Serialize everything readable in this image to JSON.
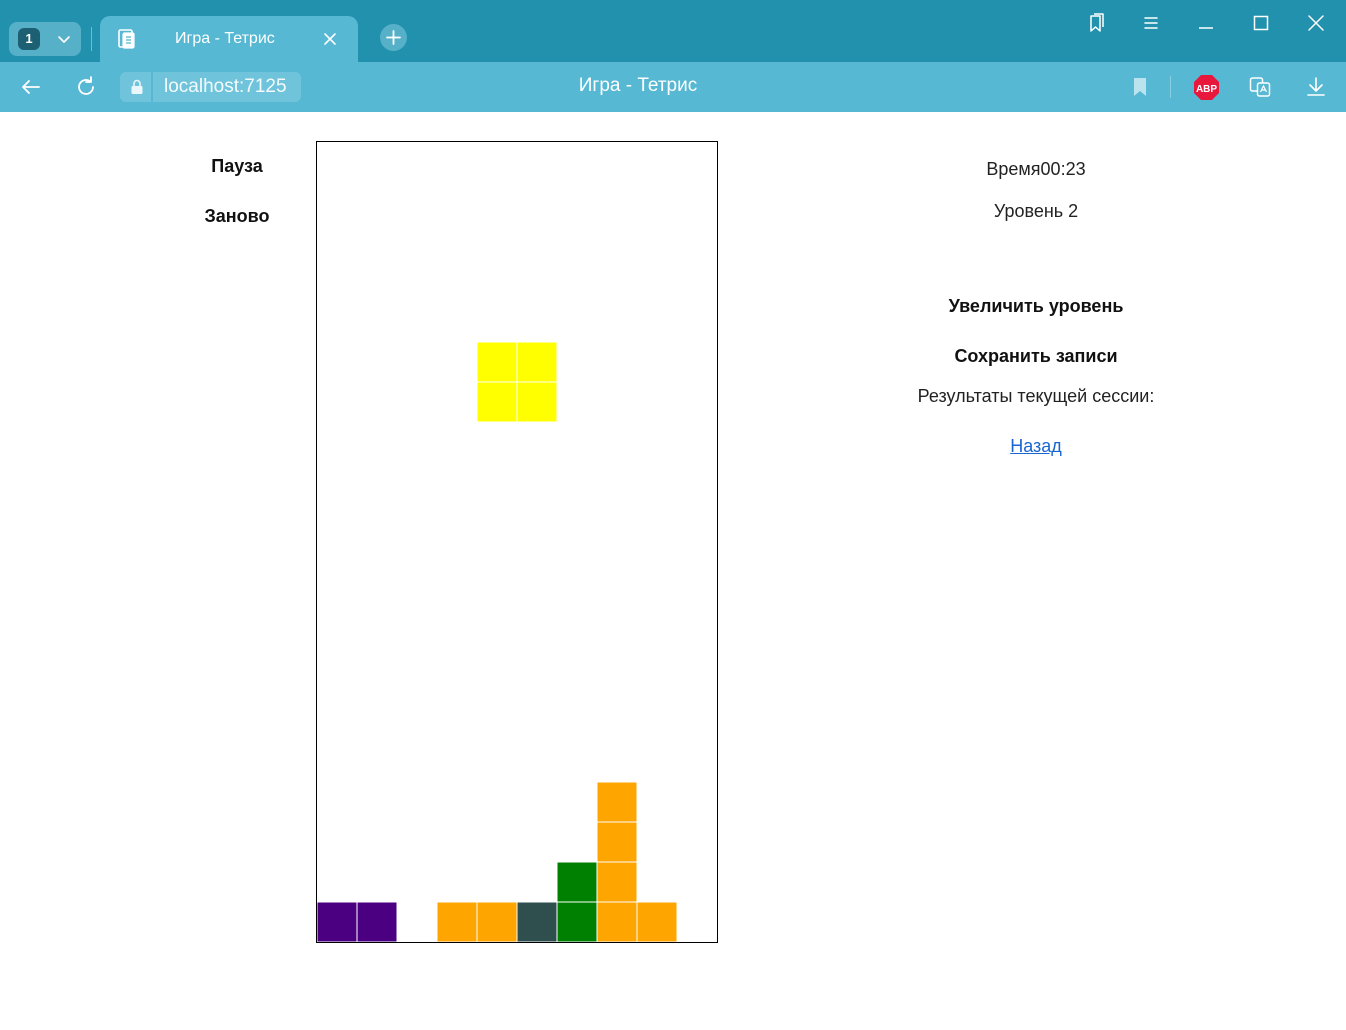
{
  "browser": {
    "tab_count": "1",
    "tab_title": "Игра - Тетрис",
    "url": "localhost:7125",
    "page_title": "Игра - Тетрис",
    "adblock_label": "ABP",
    "colors": {
      "titlebar": "#2191ae",
      "toolbar": "#56b8d3",
      "adblock": "#e8173b"
    }
  },
  "game": {
    "pause_label": "Пауза",
    "restart_label": "Заново",
    "time_label": "Время",
    "time_value": "00:23",
    "level_label": "Уровень",
    "level_value": "2",
    "increase_level_label": "Увеличить уровень",
    "save_records_label": "Сохранить записи",
    "session_results_label": "Результаты текущей сессии:",
    "back_link": "Назад"
  },
  "board": {
    "columns": 10,
    "rows": 20,
    "active_piece": {
      "type": "O",
      "color": "#ffff00",
      "cells": [
        [
          4,
          5
        ],
        [
          5,
          5
        ],
        [
          4,
          6
        ],
        [
          5,
          6
        ]
      ]
    },
    "locked_cells": [
      {
        "col": 0,
        "row": 19,
        "color": "#4b0082"
      },
      {
        "col": 1,
        "row": 19,
        "color": "#4b0082"
      },
      {
        "col": 3,
        "row": 19,
        "color": "#ffa500"
      },
      {
        "col": 4,
        "row": 19,
        "color": "#ffa500"
      },
      {
        "col": 5,
        "row": 19,
        "color": "#2f4f4f"
      },
      {
        "col": 6,
        "row": 19,
        "color": "#008000"
      },
      {
        "col": 6,
        "row": 18,
        "color": "#008000"
      },
      {
        "col": 7,
        "row": 19,
        "color": "#ffa500"
      },
      {
        "col": 7,
        "row": 18,
        "color": "#ffa500"
      },
      {
        "col": 7,
        "row": 17,
        "color": "#ffa500"
      },
      {
        "col": 7,
        "row": 16,
        "color": "#ffa500"
      },
      {
        "col": 8,
        "row": 19,
        "color": "#ffa500"
      }
    ]
  }
}
